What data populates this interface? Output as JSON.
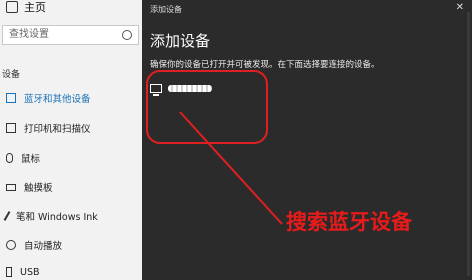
{
  "settings": {
    "home_label": "主页",
    "search_placeholder": "查找设置",
    "section_label": "设备",
    "items": [
      {
        "label": "蓝牙和其他设备",
        "icon": "bluetooth-devices-icon",
        "active": true
      },
      {
        "label": "打印机和扫描仪",
        "icon": "printer-icon",
        "active": false
      },
      {
        "label": "鼠标",
        "icon": "mouse-icon",
        "active": false
      },
      {
        "label": "触摸板",
        "icon": "touchpad-icon",
        "active": false
      },
      {
        "label": "笔和 Windows Ink",
        "icon": "pen-icon",
        "active": false
      },
      {
        "label": "自动播放",
        "icon": "autoplay-icon",
        "active": false
      },
      {
        "label": "USB",
        "icon": "usb-icon",
        "active": false
      }
    ]
  },
  "dialog": {
    "window_title": "添加设备",
    "close_glyph": "✕",
    "heading": "添加设备",
    "description": "确保你的设备已打开并可被发现。在下面选择要连接的设备。"
  },
  "annotation": {
    "text": "搜索蓝牙设备",
    "color": "#e81b1b"
  },
  "colors": {
    "dialog_bg": "#2b2b2b",
    "accent": "#1a73b8"
  }
}
